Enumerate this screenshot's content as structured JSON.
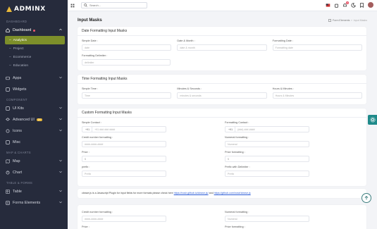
{
  "brand": {
    "name": "ADMINX"
  },
  "sidebar": {
    "sections": [
      {
        "title": "DASHBOARD"
      },
      {
        "title": "COMPONENT"
      },
      {
        "title": "MAP & CHARTS"
      },
      {
        "title": "TABLE & FORMS"
      }
    ],
    "dashboard": {
      "label": "Dashboard",
      "icon": "home-icon"
    },
    "subs": [
      "Analytics",
      "Project",
      "Ecommerce",
      "Education"
    ],
    "apps": {
      "label": "Apps"
    },
    "widgets": {
      "label": "Widgets"
    },
    "uikits": {
      "label": "UI Kits"
    },
    "advanced": {
      "label": "Advanced UI",
      "badge": "2+"
    },
    "icons": {
      "label": "Icons"
    },
    "misc": {
      "label": "Misc"
    },
    "map": {
      "label": "Map"
    },
    "chart": {
      "label": "Chart"
    },
    "table": {
      "label": "Table"
    },
    "forms": {
      "label": "Forms Elements"
    }
  },
  "topbar": {
    "search_placeholder": "Search...",
    "notification_count": "9"
  },
  "page": {
    "title": "Input Masks",
    "breadcrumb": [
      "Form Elements",
      "Input Masks"
    ]
  },
  "date_card": {
    "title": "Date Formatting Input Masks",
    "fields": [
      {
        "label": "Simple Date :",
        "placeholder": "date"
      },
      {
        "label": "Date & Month :",
        "placeholder": "date & month"
      },
      {
        "label": "Formatting Date :",
        "placeholder": "Formatting date"
      },
      {
        "label": "Formatting Delimiter :",
        "placeholder": "delimiter"
      }
    ]
  },
  "time_card": {
    "title": "Time Formatting Input Masks",
    "fields": [
      {
        "label": "Simple Time :",
        "placeholder": "Time"
      },
      {
        "label": "Minutes & Seconds :",
        "placeholder": "minutes & seconds"
      },
      {
        "label": "Hours & Minutes :",
        "placeholder": "Hours & Minutes"
      }
    ]
  },
  "custom_card": {
    "title": "Custom Formatting Input Masks",
    "fields": [
      {
        "label": "Simple Contact :",
        "prefix": "+91",
        "placeholder": "+91 ### ### ####"
      },
      {
        "label": "Formatting Contact :",
        "prefix": "+91",
        "placeholder": "(###) ###-####"
      },
      {
        "label": "Credit number formatting :",
        "placeholder": "####-####-####"
      },
      {
        "label": "Numeral formatting :",
        "placeholder": "Numeral"
      },
      {
        "label": "Price :",
        "placeholder": "$"
      },
      {
        "label": "Price formatting :",
        "placeholder": "$"
      },
      {
        "label": "prefix :",
        "placeholder": "Prefix"
      },
      {
        "label": "Prefix with Delimiter :",
        "placeholder": "Prefix"
      }
    ]
  },
  "note": {
    "text": "cleave.js is a Javascript Plugin for input fields for more formats please check here ",
    "link1": "https://nosir.github.io/cleave.js/",
    "mid": " and ",
    "link2": "https://github.com/nosir/cleave.js"
  },
  "bottom_card": {
    "fields": [
      {
        "label": "Credit number formatting :",
        "placeholder": "####-####-####"
      },
      {
        "label": "Numeral formatting :",
        "placeholder": "Numeral"
      },
      {
        "label": "Price :"
      },
      {
        "label": "Price formatting :"
      }
    ]
  },
  "colors": {
    "sidebar": "#262b3c",
    "active": "#7d8f2a",
    "accent": "#1f8a8a"
  }
}
